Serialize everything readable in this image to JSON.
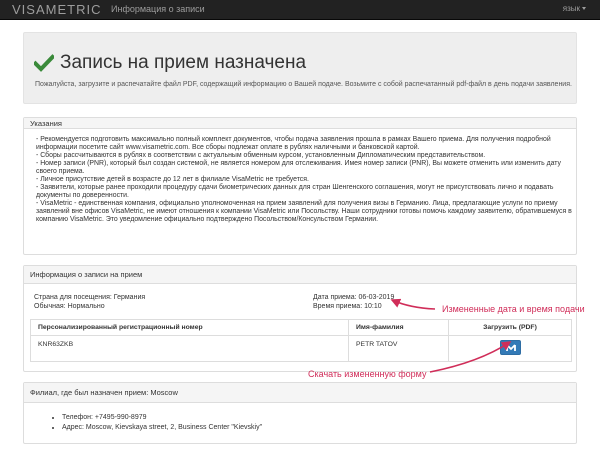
{
  "navbar": {
    "brand": "VISAMETRIC",
    "link": "Информация о записи",
    "lang": "язык"
  },
  "success": {
    "title": "Запись на прием назначена",
    "subtitle": "Пожалуйста, загрузите и распечатайте файл PDF, содержащий информацию о Вашей подаче. Возьмите с собой распечатанный pdf-файл в день подачи заявления.",
    "icon": "checkmark-icon",
    "color": "#3a8a3a"
  },
  "instructions": {
    "heading": "Указания",
    "lines": [
      " - Рекомендуется  подготовить максимально полный комплект документов, чтобы подача заявления прошла в рамках Вашего приема. Для получения подробной",
      "информации посетите сайт www.visametric.com. Все сборы подлежат оплате в рублях наличными и банковской картой.",
      "- Сборы рассчитываются в рублях в соответствии с актуальным обменным курсом, установленным Дипломатическим представительством.",
      "- Номер записи (PNR), который был создан системой, не является номером для отслеживания. Имея номер записи (PNR), Вы можете отменить или изменить дату",
      "своего приема.",
      "- Личное присутствие детей в возрасте до 12 лет в филиале VisaMetric не требуется.",
      "- Заявители, которые ранее проходили процедуру сдачи биометрических данных для стран Шенгенского соглашения, могут не присутствовать лично и подавать",
      "документы по доверенности.",
      "- VisaMetric - единственная компания, официально уполномоченная на прием заявлений для получения визы в Германию. Лица, предлагающие услуги по приему",
      "заявлений вне офисов VisaMetric, не имеют отношения к компании VisaMetric или Посольству. Наши сотрудники готовы помочь каждому заявителю, обратившемуся в",
      "компанию VisaMetric. Это уведомление  официально подтверждено Посольством/Консульством Германии."
    ]
  },
  "appointment": {
    "heading": "Информация о записи на прием",
    "country_label": "Страна для посещения: Германия",
    "type_label": "Обычная: Нормально",
    "date_label": "Дата приема: 06-03-2019",
    "time_label": "Время приема: 10:10",
    "table": {
      "headers": [
        "Персонализированный регистрационный номер",
        "Имя-фамилия",
        "Загрузить (PDF)"
      ],
      "rows": [
        {
          "pnr": "KNR63ZKB",
          "name": "PETR TATOV"
        }
      ]
    },
    "download_icon": "pdf-download-icon"
  },
  "branch": {
    "heading": "Филиал, где был назначен прием: Moscow",
    "items": [
      "Телефон: +7495-990-8979",
      "Адрес: Moscow, Kievskaya street, 2, Business Center \"Kievskiy\""
    ]
  },
  "annotations": {
    "changed_date": "Измененные дата и время подачи",
    "download_changed": "Скачать измененную форму",
    "color": "#d02d59"
  }
}
